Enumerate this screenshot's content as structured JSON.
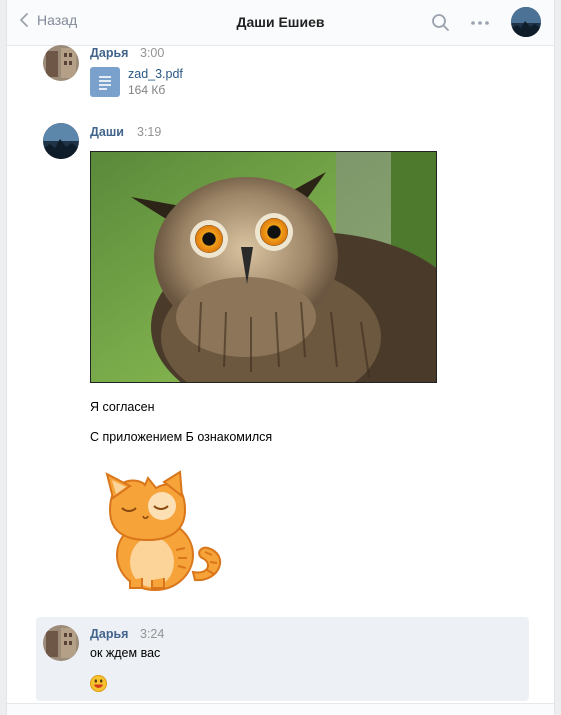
{
  "header": {
    "back_label": "Назад",
    "title": "Даши Ешиев"
  },
  "messages": [
    {
      "author": "Дарья",
      "time": "3:00",
      "attachment": {
        "file_name": "zad_3.pdf",
        "file_size": "164 Кб",
        "icon": "document-icon"
      }
    },
    {
      "author": "Даши",
      "time": "3:19",
      "photo": "owl-photo",
      "texts": [
        "Я согласен",
        "С приложением Б ознакомился"
      ],
      "sticker": "cat-sticker"
    },
    {
      "author": "Дарья",
      "time": "3:24",
      "text": "ок ждем вас",
      "emoji": "smile-emoji"
    }
  ],
  "colors": {
    "link": "#2a5885",
    "name": "#42648b",
    "selected_bg": "#edf0f5"
  }
}
